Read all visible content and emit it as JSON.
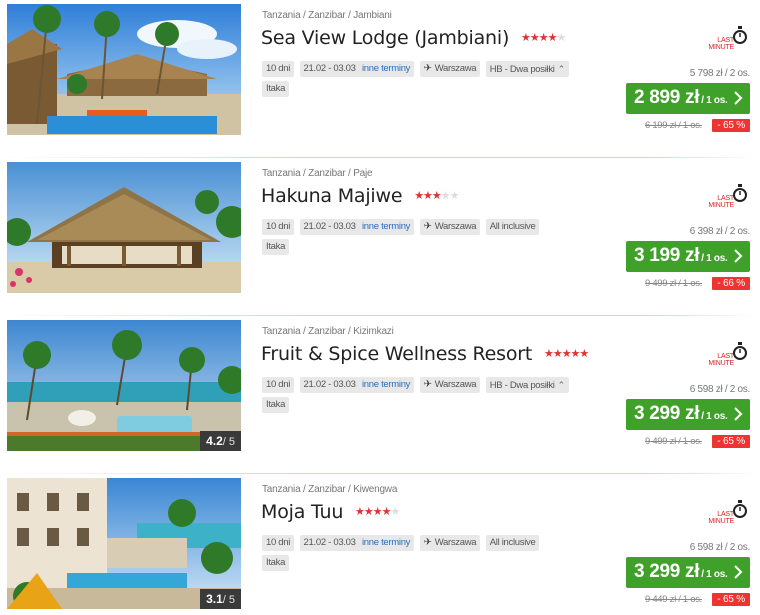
{
  "offers": [
    {
      "location": "Tanzania / Zanzibar / Jambiani",
      "name": "Sea View Lodge (Jambiani)",
      "stars": "★★★★",
      "stars_empty": "★",
      "days": "10 dni",
      "dates": "21.02 - 03.03",
      "other_dates": "inne terminy",
      "departure": "Warszawa",
      "board": "HB - Dwa posiłki",
      "board_chevron": "^",
      "operator": "Itaka",
      "lm_label": "LAST MINUTE",
      "price_per_two": "5 798 zł / 2 os.",
      "price": "2 899 zł",
      "per_person": "/ 1 os.",
      "old_price": "6 199 zł / 1 os.",
      "discount": "- 65 %",
      "rating": "",
      "rating_of": ""
    },
    {
      "location": "Tanzania / Zanzibar / Paje",
      "name": "Hakuna Majiwe",
      "stars": "★★★",
      "stars_empty": "★★",
      "days": "10 dni",
      "dates": "21.02 - 03.03",
      "other_dates": "inne terminy",
      "departure": "Warszawa",
      "board": "All inclusive",
      "board_chevron": "",
      "operator": "Itaka",
      "lm_label": "LAST MINUTE",
      "price_per_two": "6 398 zł / 2 os.",
      "price": "3 199 zł",
      "per_person": "/ 1 os.",
      "old_price": "9 499 zł / 1 os.",
      "discount": "- 66 %",
      "rating": "",
      "rating_of": ""
    },
    {
      "location": "Tanzania / Zanzibar / Kizimkazi",
      "name": "Fruit & Spice Wellness Resort",
      "stars": "★★★★★",
      "stars_empty": "",
      "days": "10 dni",
      "dates": "21.02 - 03.03",
      "other_dates": "inne terminy",
      "departure": "Warszawa",
      "board": "HB - Dwa posiłki",
      "board_chevron": "^",
      "operator": "Itaka",
      "lm_label": "LAST MINUTE",
      "price_per_two": "6 598 zł / 2 os.",
      "price": "3 299 zł",
      "per_person": "/ 1 os.",
      "old_price": "9 499 zł / 1 os.",
      "discount": "- 65 %",
      "rating": "4.2",
      "rating_of": "/ 5"
    },
    {
      "location": "Tanzania / Zanzibar / Kiwengwa",
      "name": "Moja Tuu",
      "stars": "★★★★",
      "stars_empty": "★",
      "days": "10 dni",
      "dates": "21.02 - 03.03",
      "other_dates": "inne terminy",
      "departure": "Warszawa",
      "board": "All inclusive",
      "board_chevron": "",
      "operator": "Itaka",
      "lm_label": "LAST MINUTE",
      "price_per_two": "6 598 zł / 2 os.",
      "price": "3 299 zł",
      "per_person": "/ 1 os.",
      "old_price": "9 449 zł / 1 os.",
      "discount": "- 65 %",
      "rating": "3.1",
      "rating_of": "/ 5"
    }
  ],
  "colors": {
    "price_green": "#3fa12a",
    "discount_red": "#e33",
    "star_red": "#d33",
    "link_blue": "#2a6fbf"
  },
  "icons": {
    "last_minute": "stopwatch-icon",
    "flight": "plane-icon",
    "arrow": "chevron-right-icon"
  }
}
